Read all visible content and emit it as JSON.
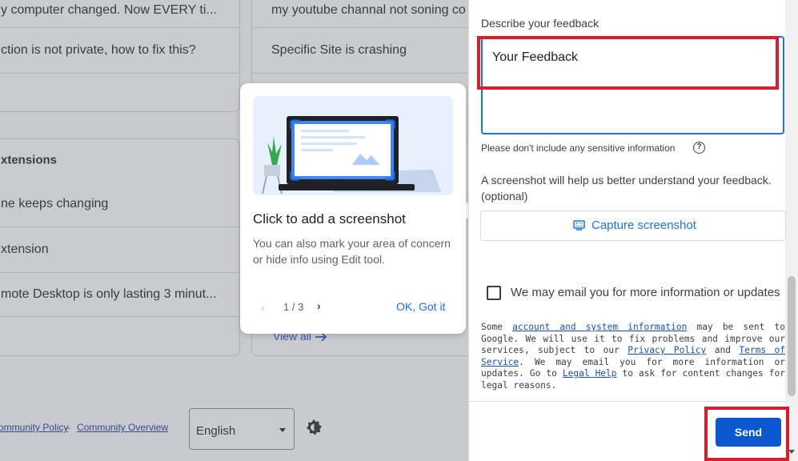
{
  "background": {
    "left_rows": [
      "y computer changed. Now EVERY ti...",
      "ction is not private, how to fix this?",
      "",
      "xtensions",
      "ne keeps changing",
      "xtension",
      "mote Desktop is only lasting 3 minut...",
      ""
    ],
    "right_rows": [
      "my youtube channal not soning co",
      "Specific Site is crashing"
    ],
    "view_all": "View all",
    "footer": {
      "link_1": "ommunity Policy",
      "separator": " - ",
      "link_2": "Community Overview",
      "language": "English"
    }
  },
  "coach": {
    "title": "Click to add a screenshot",
    "description": "You can also mark your area of concern or hide info using Edit tool.",
    "prev": "‹",
    "counter": "1 / 3",
    "next": "›",
    "ok_label": "OK, Got it"
  },
  "feedback": {
    "label": "Describe your feedback",
    "value": "Your Feedback",
    "sensitive_note": "Please don't include any sensitive information",
    "screenshot_info": "A screenshot will help us better understand your feedback. (optional)",
    "capture_label": "Capture screenshot",
    "email_opt_in": "We may email you for more information or updates",
    "legal": {
      "t1": "Some ",
      "l1": "account and system information",
      "t2": " may be sent to Google. We will use it to fix problems and improve our services, subject to our ",
      "l2": "Privacy Policy",
      "t3": " and ",
      "l3": "Terms of Service",
      "t4": ". We may email you for more information or updates. Go to ",
      "l4": "Legal Help",
      "t5": " to ask for content changes for legal reasons."
    },
    "send_label": "Send"
  },
  "colors": {
    "accent": "#1a73e8",
    "send": "#0b57d0",
    "highlight": "#d81e2c"
  }
}
